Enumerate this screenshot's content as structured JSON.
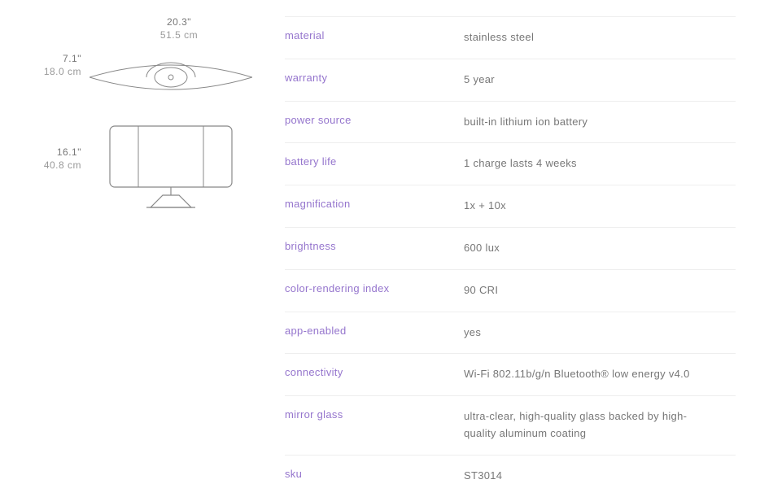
{
  "dimensions": {
    "width_in": "20.3\"",
    "width_cm": "51.5 cm",
    "depth_in": "7.1\"",
    "depth_cm": "18.0 cm",
    "height_in": "16.1\"",
    "height_cm": "40.8 cm"
  },
  "specs": [
    {
      "label": "material",
      "value": "stainless steel"
    },
    {
      "label": "warranty",
      "value": "5 year"
    },
    {
      "label": "power source",
      "value": "built-in lithium ion battery"
    },
    {
      "label": "battery life",
      "value": "1 charge lasts 4 weeks"
    },
    {
      "label": "magnification",
      "value": "1x + 10x"
    },
    {
      "label": "brightness",
      "value": "600 lux"
    },
    {
      "label": "color-rendering index",
      "value": "90 CRI"
    },
    {
      "label": "app-enabled",
      "value": "yes"
    },
    {
      "label": "connectivity",
      "value": "Wi-Fi 802.11b/g/n Bluetooth® low energy v4.0"
    },
    {
      "label": "mirror glass",
      "value": "ultra-clear, high-quality glass backed by high-quality aluminum coating"
    },
    {
      "label": "sku",
      "value": "ST3014"
    }
  ]
}
